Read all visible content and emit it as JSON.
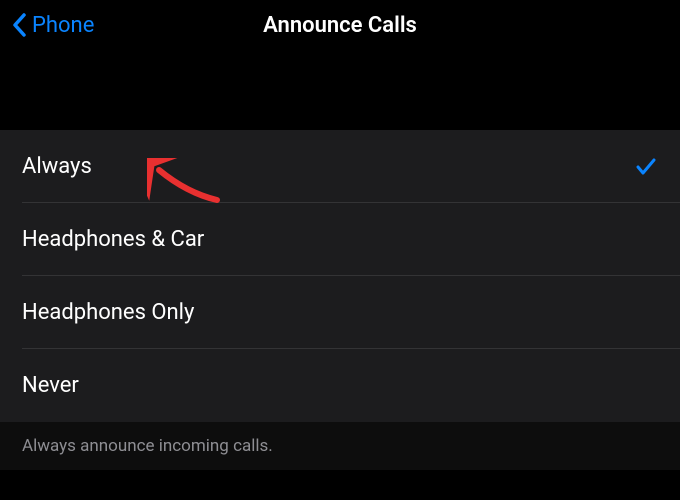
{
  "nav": {
    "back_label": "Phone",
    "title": "Announce Calls"
  },
  "options": {
    "items": [
      {
        "label": "Always",
        "selected": true
      },
      {
        "label": "Headphones & Car",
        "selected": false
      },
      {
        "label": "Headphones Only",
        "selected": false
      },
      {
        "label": "Never",
        "selected": false
      }
    ]
  },
  "footer": {
    "description": "Always announce incoming calls."
  },
  "colors": {
    "accent": "#0a84ff",
    "background": "#000000",
    "row_background": "#1c1c1e",
    "text_primary": "#ffffff",
    "text_secondary": "#8e8e93"
  }
}
